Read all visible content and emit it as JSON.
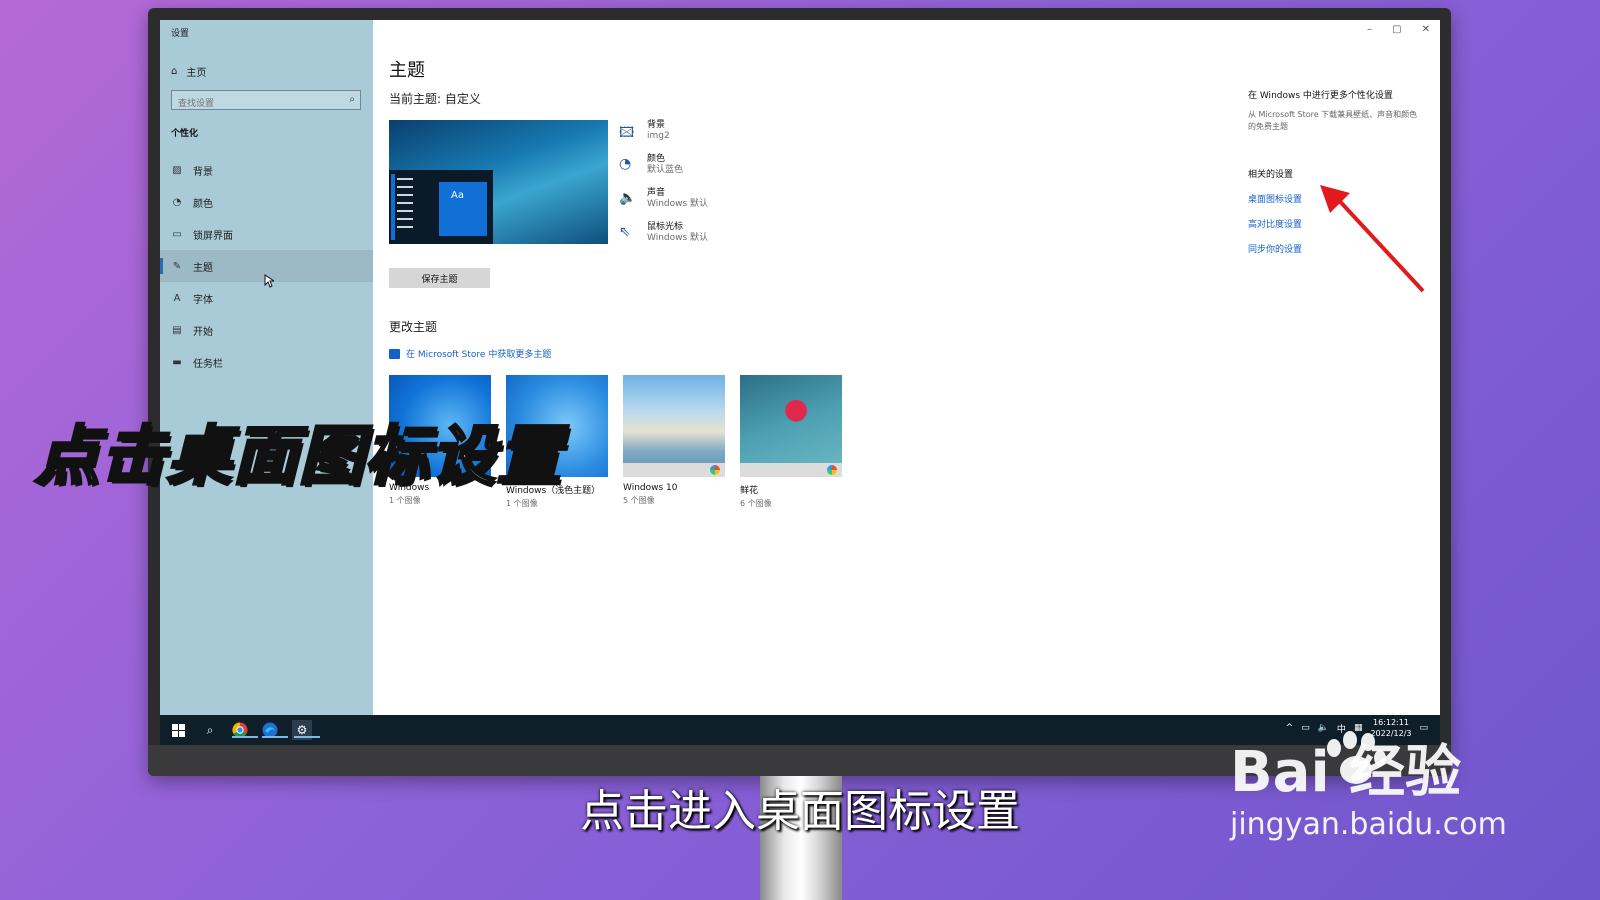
{
  "window": {
    "title": "设置",
    "controls": [
      "–",
      "▢",
      "✕"
    ]
  },
  "sidebar": {
    "home_label": "主页",
    "search_placeholder": "查找设置",
    "section_title": "个性化",
    "items": [
      {
        "label": "背景",
        "icon": "image-icon"
      },
      {
        "label": "颜色",
        "icon": "palette-icon"
      },
      {
        "label": "锁屏界面",
        "icon": "lockscreen-icon"
      },
      {
        "label": "主题",
        "icon": "theme-icon",
        "active": true
      },
      {
        "label": "字体",
        "icon": "font-icon"
      },
      {
        "label": "开始",
        "icon": "start-icon"
      },
      {
        "label": "任务栏",
        "icon": "taskbar-icon"
      }
    ]
  },
  "main": {
    "title": "主题",
    "current_theme": "当前主题: 自定义",
    "preview_text": "Aa",
    "properties": [
      {
        "name": "背景",
        "value": "img2",
        "icon": "image-icon"
      },
      {
        "name": "颜色",
        "value": "默认蓝色",
        "icon": "palette-icon"
      },
      {
        "name": "声音",
        "value": "Windows 默认",
        "icon": "speaker-icon"
      },
      {
        "name": "鼠标光标",
        "value": "Windows 默认",
        "icon": "cursor-icon"
      }
    ],
    "save_button": "保存主题",
    "change_title": "更改主题",
    "store_link": "在 Microsoft Store 中获取更多主题",
    "themes": [
      {
        "name": "Windows",
        "count": "1 个图像"
      },
      {
        "name": "Windows（浅色主题）",
        "count": "1 个图像"
      },
      {
        "name": "Windows 10",
        "count": "5 个图像"
      },
      {
        "name": "鲜花",
        "count": "6 个图像"
      }
    ]
  },
  "right": {
    "heading": "在 Windows 中进行更多个性化设置",
    "description": "从 Microsoft Store 下载兼具壁纸、声音和颜色的免费主题",
    "related_title": "相关的设置",
    "links": [
      "桌面图标设置",
      "高对比度设置",
      "同步你的设置"
    ]
  },
  "taskbar": {
    "tray_lang": "中",
    "time": "16:12:11",
    "date": "2022/12/3"
  },
  "overlay": {
    "big_caption": "点击桌面图标设置",
    "subtitle": "点击进入桌面图标设置",
    "watermark_logo": "Bai 经验",
    "watermark_url": "jingyan.baidu.com"
  }
}
